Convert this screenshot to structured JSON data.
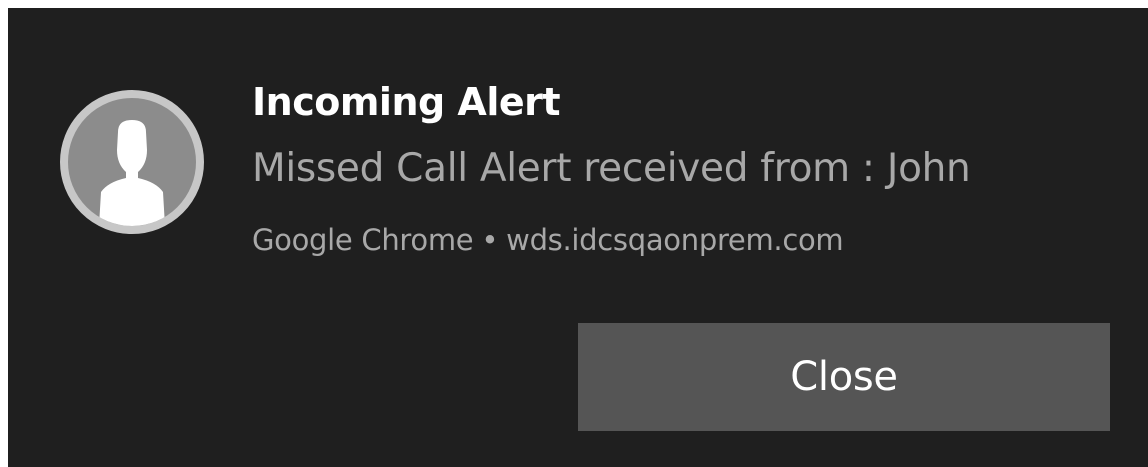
{
  "notification": {
    "avatar_icon": "user-silhouette-icon",
    "title": "Incoming Alert",
    "message": "Missed Call Alert received from : John",
    "app_name": "Google Chrome",
    "separator": "•",
    "origin": "wds.idcsqaonprem.com",
    "close_label": "Close"
  },
  "colors": {
    "background": "#1f1f1f",
    "title": "#ffffff",
    "secondary_text": "#a8a8a8",
    "button": "#555555",
    "avatar_fill": "#8c8c8c",
    "avatar_ring": "#c7c7c7"
  }
}
